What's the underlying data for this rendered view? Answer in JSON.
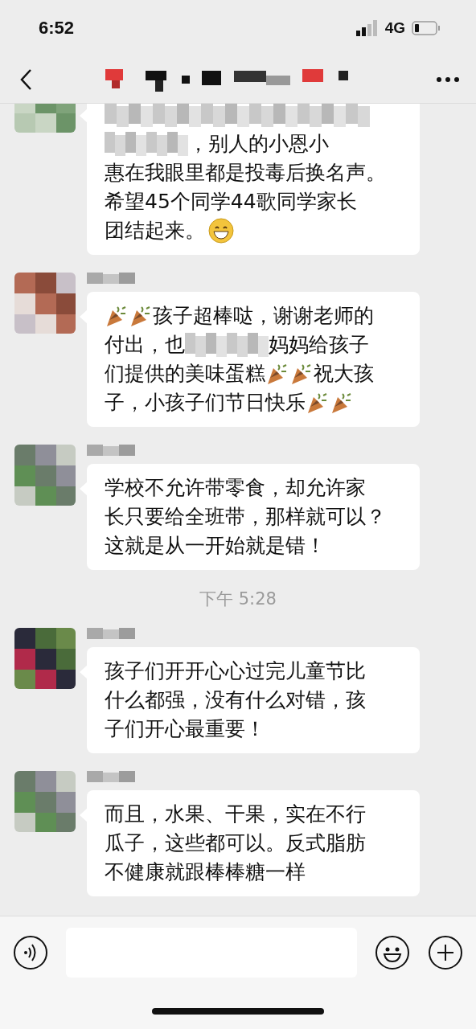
{
  "status_bar": {
    "time": "6:52",
    "network": "4G"
  },
  "chat": [
    {
      "kind": "message",
      "lines": [
        [
          {
            "kind": "blurred-line"
          }
        ],
        [
          {
            "kind": "blur"
          },
          {
            "kind": "text",
            "text": "，别人的小恩小"
          }
        ],
        [
          {
            "kind": "text",
            "text": "惠在我眼里都是投毒后换名声。"
          }
        ],
        [
          {
            "kind": "text",
            "text": "希望45个同学44歌同学家长"
          }
        ],
        [
          {
            "kind": "text",
            "text": "团结起来。"
          },
          {
            "kind": "grin"
          }
        ]
      ]
    },
    {
      "kind": "message",
      "lines": [
        [
          {
            "kind": "party"
          },
          {
            "kind": "party"
          },
          {
            "kind": "text",
            "text": "孩子超棒哒，谢谢老师的"
          }
        ],
        [
          {
            "kind": "text",
            "text": "付出，也"
          },
          {
            "kind": "blur"
          },
          {
            "kind": "text",
            "text": "妈妈给孩子"
          }
        ],
        [
          {
            "kind": "text",
            "text": "们提供的美味蛋糕"
          },
          {
            "kind": "party"
          },
          {
            "kind": "party"
          },
          {
            "kind": "text",
            "text": "祝大孩"
          }
        ],
        [
          {
            "kind": "text",
            "text": "子，小孩子们节日快乐"
          },
          {
            "kind": "party"
          },
          {
            "kind": "party"
          }
        ]
      ]
    },
    {
      "kind": "message",
      "lines": [
        [
          {
            "kind": "text",
            "text": "学校不允许带零食，却允许家"
          }
        ],
        [
          {
            "kind": "text",
            "text": "长只要给全班带，那样就可以？"
          }
        ],
        [
          {
            "kind": "text",
            "text": "这就是从一开始就是错！"
          }
        ]
      ]
    },
    {
      "kind": "time",
      "text": "下午 5:28"
    },
    {
      "kind": "message",
      "lines": [
        [
          {
            "kind": "text",
            "text": "孩子们开开心心过完儿童节比"
          }
        ],
        [
          {
            "kind": "text",
            "text": "什么都强，没有什么对错，孩"
          }
        ],
        [
          {
            "kind": "text",
            "text": "子们开心最重要！"
          }
        ]
      ]
    },
    {
      "kind": "message",
      "lines": [
        [
          {
            "kind": "text",
            "text": "而且，水果、干果，实在不行"
          }
        ],
        [
          {
            "kind": "text",
            "text": "瓜子，这些都可以。反式脂肪"
          }
        ],
        [
          {
            "kind": "text",
            "text": "不健康就跟棒棒糖一样"
          }
        ]
      ]
    }
  ]
}
